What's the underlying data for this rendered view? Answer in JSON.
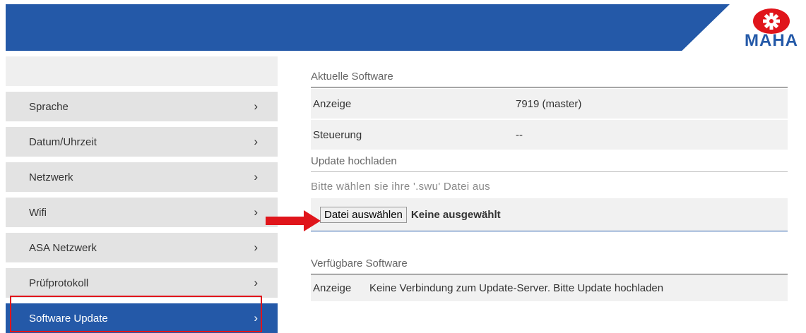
{
  "header": {
    "brand": "MAHA",
    "band_color": "#2459a8"
  },
  "sidebar": {
    "items": [
      {
        "label": "Sprache",
        "chevron": "›"
      },
      {
        "label": "Datum/Uhrzeit",
        "chevron": "›"
      },
      {
        "label": "Netzwerk",
        "chevron": "›"
      },
      {
        "label": "Wifi",
        "chevron": "›"
      },
      {
        "label": "ASA Netzwerk",
        "chevron": "›"
      },
      {
        "label": "Prüfprotokoll",
        "chevron": "›"
      },
      {
        "label": "Software Update",
        "chevron": "›",
        "active": true
      }
    ]
  },
  "main": {
    "current": {
      "title": "Aktuelle Software",
      "rows": [
        {
          "key": "Anzeige",
          "value": "7919 (master)"
        },
        {
          "key": "Steuerung",
          "value": "--"
        }
      ]
    },
    "upload": {
      "title": "Update hochladen",
      "hint": "Bitte wählen sie ihre '.swu' Datei aus",
      "button_label": "Datei auswählen",
      "status": "Keine ausgewählt"
    },
    "available": {
      "title": "Verfügbare Software",
      "rows": [
        {
          "key": "Anzeige",
          "value": "Keine Verbindung zum Update-Server. Bitte Update hochladen"
        }
      ]
    }
  },
  "annotation": {
    "arrow_color": "#e0151b",
    "outline_color": "#e0151b"
  }
}
